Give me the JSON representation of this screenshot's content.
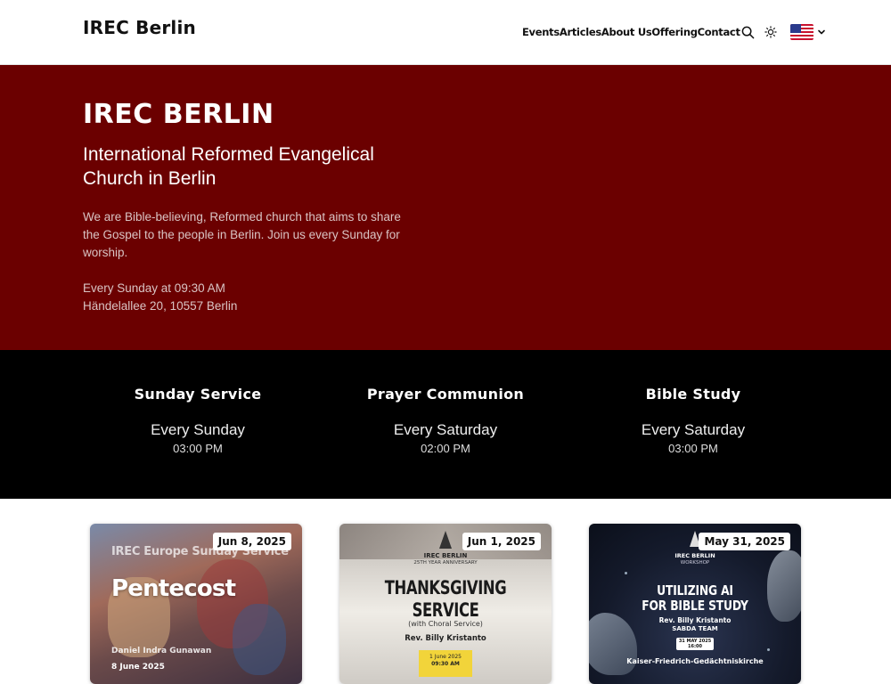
{
  "header": {
    "brand": "IREC Berlin",
    "nav": [
      "Events",
      "Articles",
      "About Us",
      "Offering",
      "Contact"
    ],
    "icons": [
      "search-icon",
      "sun-icon",
      "us-flag-icon",
      "chevron-down-icon"
    ]
  },
  "hero": {
    "title": "IREC BERLIN",
    "subtitle": "International Reformed Evangelical Church in Berlin",
    "description": "We are Bible-believing, Reformed church that aims to share the Gospel to the people in Berlin. Join us every Sunday for worship.",
    "time": "Every Sunday at 09:30 AM",
    "address": "Händelallee 20, 10557 Berlin",
    "background": "#6b0000"
  },
  "schedule": [
    {
      "title": "Sunday Service",
      "day": "Every Sunday",
      "time": "03:00 PM"
    },
    {
      "title": "Prayer Communion",
      "day": "Every Saturday",
      "time": "02:00 PM"
    },
    {
      "title": "Bible Study",
      "day": "Every Saturday",
      "time": "03:00 PM"
    }
  ],
  "events": [
    {
      "date": "Jun 8, 2025",
      "poster_heading": "IREC Europe Sunday Service",
      "poster_title": "Pentecost",
      "poster_speaker": "Daniel Indra Gunawan",
      "poster_date": "8 June 2025"
    },
    {
      "date": "Jun 1, 2025",
      "poster_org": "IREC BERLIN",
      "poster_anniversary": "25TH YEAR ANNIVERSARY",
      "poster_title1": "THANKSGIVING",
      "poster_title2": "SERVICE",
      "poster_sub": "(with Choral Service)",
      "poster_speaker": "Rev. Billy Kristanto",
      "poster_date": "1 June 2025",
      "poster_time": "09:30 AM"
    },
    {
      "date": "May 31, 2025",
      "poster_org": "IREC BERLIN",
      "poster_kind": "WORKSHOP",
      "poster_title1": "UTILIZING AI",
      "poster_title2": "FOR BIBLE STUDY",
      "poster_speaker": "Rev. Billy Kristanto",
      "poster_team": "SABDA TEAM",
      "poster_date": "31 MAY 2025",
      "poster_time": "16:00",
      "poster_venue": "Kaiser-Friedrich-Gedächtniskirche"
    }
  ]
}
